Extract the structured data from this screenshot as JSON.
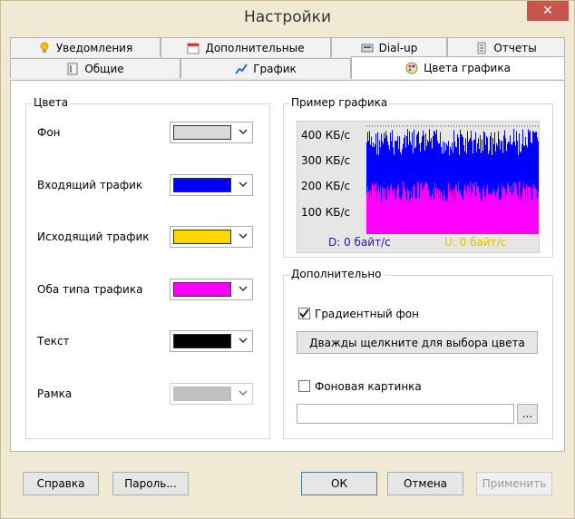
{
  "window": {
    "title": "Настройки",
    "close_glyph": "✕"
  },
  "tabs": {
    "row_back": [
      {
        "label": "Уведомления",
        "icon": "lightbulb-icon"
      },
      {
        "label": "Дополнительные",
        "icon": "calendar-icon"
      },
      {
        "label": "Dial-up",
        "icon": "modem-icon"
      },
      {
        "label": "Отчеты",
        "icon": "report-icon"
      }
    ],
    "row_front": [
      {
        "label": "Общие",
        "icon": "general-icon"
      },
      {
        "label": "График",
        "icon": "chart-icon"
      },
      {
        "label": "Цвета графика",
        "icon": "palette-icon",
        "active": true
      }
    ]
  },
  "colors_group": {
    "title": "Цвета",
    "items": [
      {
        "label": "Фон",
        "color": "#d9d9d9"
      },
      {
        "label": "Входящий трафик",
        "color": "#0000ff"
      },
      {
        "label": "Исходящий трафик",
        "color": "#ffd700"
      },
      {
        "label": "Оба типа трафика",
        "color": "#ff00ff"
      },
      {
        "label": "Текст",
        "color": "#000000"
      },
      {
        "label": "Рамка",
        "color": "#c0c0c0",
        "disabled": true
      }
    ]
  },
  "preview_group": {
    "title": "Пример графика",
    "y_labels": [
      "400 КБ/с",
      "300 КБ/с",
      "200 КБ/с",
      "100 КБ/с"
    ],
    "status_download": "D: 0 байт/с",
    "status_upload": "U: 0 байт/с",
    "download_color": "#1a1aa8",
    "upload_color": "#e2c000"
  },
  "extra_group": {
    "title": "Дополнительно",
    "gradient_label": "Градиентный фон",
    "gradient_checked": true,
    "pick_color_button": "Дважды щелкните для выбора цвета",
    "background_image_label": "Фоновая картинка",
    "background_image_checked": false,
    "background_image_path": "",
    "browse_button": "..."
  },
  "footer": {
    "help_button": "Справка",
    "password_button": "Пароль...",
    "ok_button": "ОК",
    "cancel_button": "Отмена",
    "apply_button": "Применить"
  }
}
